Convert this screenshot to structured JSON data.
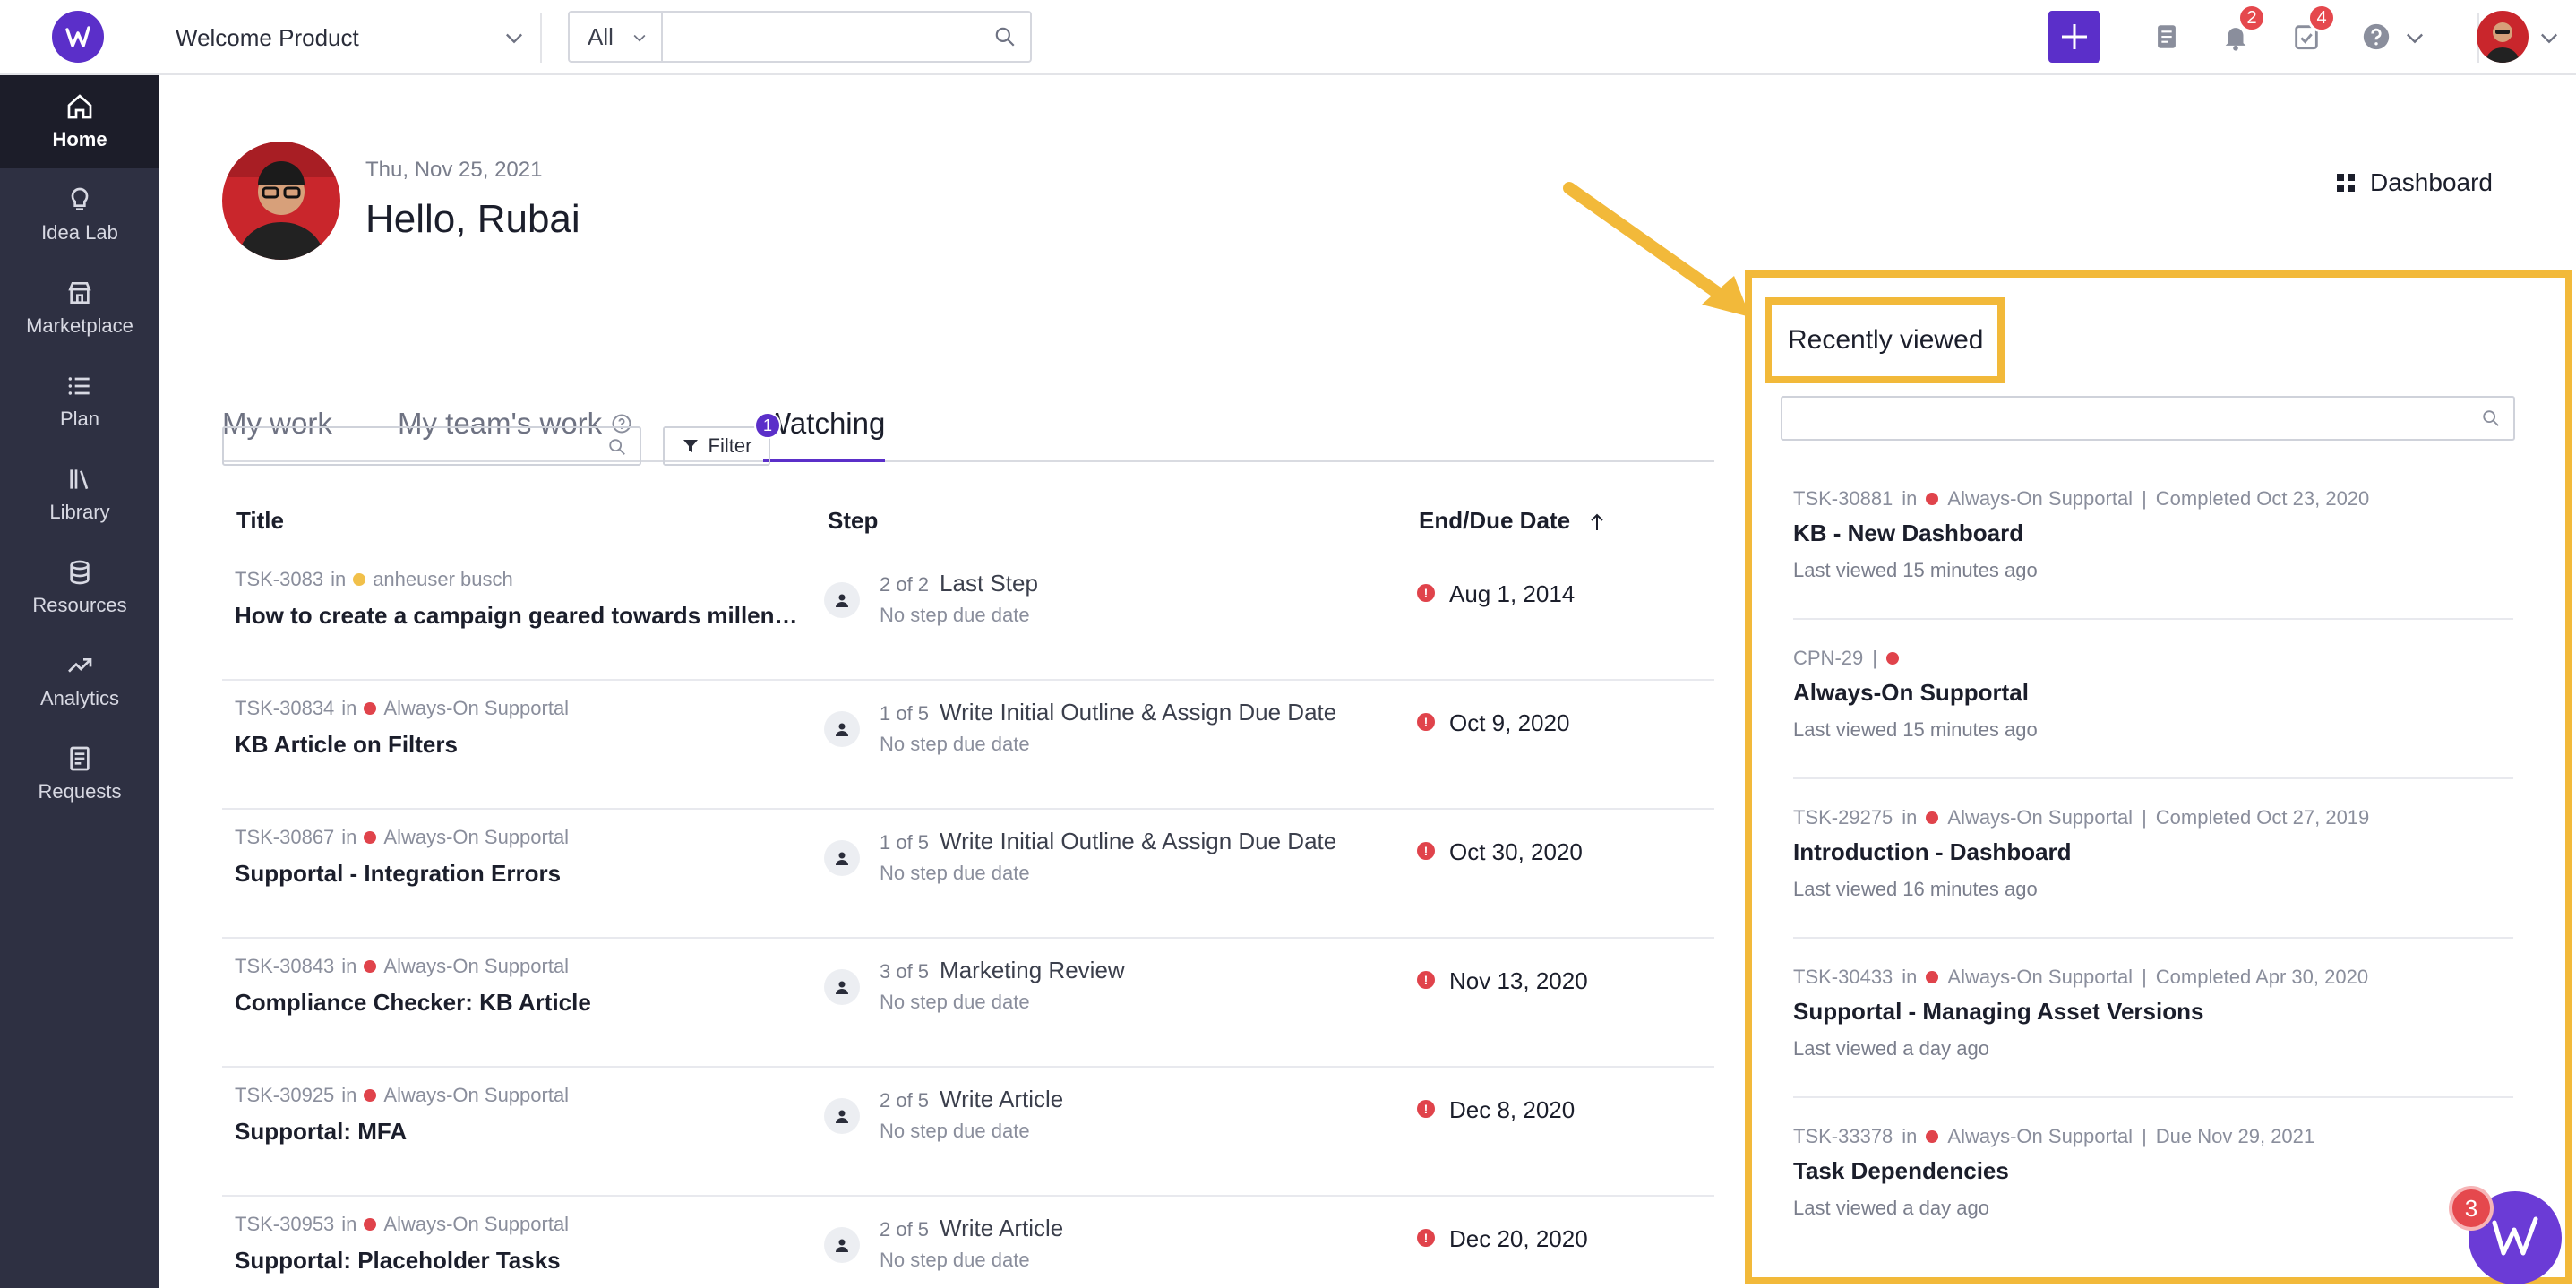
{
  "topbar": {
    "workspace": "Welcome Product",
    "search_scope": "All",
    "search_placeholder": "",
    "notifications_count": "2",
    "tasks_count": "4"
  },
  "sidebar": {
    "items": [
      {
        "label": "Home",
        "icon": "home-icon"
      },
      {
        "label": "Idea Lab",
        "icon": "lightbulb-icon"
      },
      {
        "label": "Marketplace",
        "icon": "store-icon"
      },
      {
        "label": "Plan",
        "icon": "list-icon"
      },
      {
        "label": "Library",
        "icon": "library-icon"
      },
      {
        "label": "Resources",
        "icon": "database-icon"
      },
      {
        "label": "Analytics",
        "icon": "trend-icon"
      },
      {
        "label": "Requests",
        "icon": "form-icon"
      }
    ]
  },
  "header": {
    "date": "Thu, Nov 25, 2021",
    "greeting": "Hello, Rubai",
    "dashboard_label": "Dashboard"
  },
  "tabs": [
    "My work",
    "My team's work",
    "Watching"
  ],
  "filter": {
    "label": "Filter",
    "count": "1"
  },
  "table": {
    "columns": [
      "Title",
      "Step",
      "End/Due Date"
    ],
    "rows": [
      {
        "id": "TSK-3083",
        "in": "in",
        "campaign": "anheuser busch",
        "dot": "yellow",
        "title": "How to create a campaign geared towards millenni...",
        "step_count": "2 of 2",
        "step_name": "Last Step",
        "step_due": "No step due date",
        "due": "Aug 1, 2014"
      },
      {
        "id": "TSK-30834",
        "in": "in",
        "campaign": "Always-On Supportal",
        "dot": "red",
        "title": "KB Article on Filters",
        "step_count": "1 of 5",
        "step_name": "Write Initial Outline & Assign Due Date",
        "step_due": "No step due date",
        "due": "Oct 9, 2020"
      },
      {
        "id": "TSK-30867",
        "in": "in",
        "campaign": "Always-On Supportal",
        "dot": "red",
        "title": "Supportal - Integration Errors",
        "step_count": "1 of 5",
        "step_name": "Write Initial Outline & Assign Due Date",
        "step_due": "No step due date",
        "due": "Oct 30, 2020"
      },
      {
        "id": "TSK-30843",
        "in": "in",
        "campaign": "Always-On Supportal",
        "dot": "red",
        "title": "Compliance Checker: KB Article",
        "step_count": "3 of 5",
        "step_name": "Marketing Review",
        "step_due": "No step due date",
        "due": "Nov 13, 2020"
      },
      {
        "id": "TSK-30925",
        "in": "in",
        "campaign": "Always-On Supportal",
        "dot": "red",
        "title": "Supportal: MFA",
        "step_count": "2 of 5",
        "step_name": "Write Article",
        "step_due": "No step due date",
        "due": "Dec 8, 2020"
      },
      {
        "id": "TSK-30953",
        "in": "in",
        "campaign": "Always-On Supportal",
        "dot": "red",
        "title": "Supportal: Placeholder Tasks",
        "step_count": "2 of 5",
        "step_name": "Write Article",
        "step_due": "No step due date",
        "due": "Dec 20, 2020"
      }
    ]
  },
  "recently_viewed": {
    "title": "Recently viewed",
    "items": [
      {
        "id": "TSK-30881",
        "in": "in",
        "campaign": "Always-On Supportal",
        "sep": "|",
        "status": "Completed Oct 23, 2020",
        "title": "KB - New Dashboard",
        "viewed": "Last viewed 15 minutes ago"
      },
      {
        "id": "CPN-29",
        "in": "",
        "campaign": "",
        "sep": "|",
        "status": "",
        "title": "Always-On Supportal",
        "viewed": "Last viewed 15 minutes ago"
      },
      {
        "id": "TSK-29275",
        "in": "in",
        "campaign": "Always-On Supportal",
        "sep": "|",
        "status": "Completed Oct 27, 2019",
        "title": "Introduction - Dashboard",
        "viewed": "Last viewed 16 minutes ago"
      },
      {
        "id": "TSK-30433",
        "in": "in",
        "campaign": "Always-On Supportal",
        "sep": "|",
        "status": "Completed Apr 30, 2020",
        "title": "Supportal - Managing Asset Versions",
        "viewed": "Last viewed a day ago"
      },
      {
        "id": "TSK-33378",
        "in": "in",
        "campaign": "Always-On Supportal",
        "sep": "|",
        "status": "Due Nov 29, 2021",
        "title": "Task Dependencies",
        "viewed": "Last viewed a day ago"
      }
    ]
  },
  "chat": {
    "unread": "3"
  },
  "colors": {
    "brand": "#5b2fc9",
    "sidebar": "#2e3042",
    "highlight": "#f2b93a",
    "alert": "#e0434b"
  }
}
